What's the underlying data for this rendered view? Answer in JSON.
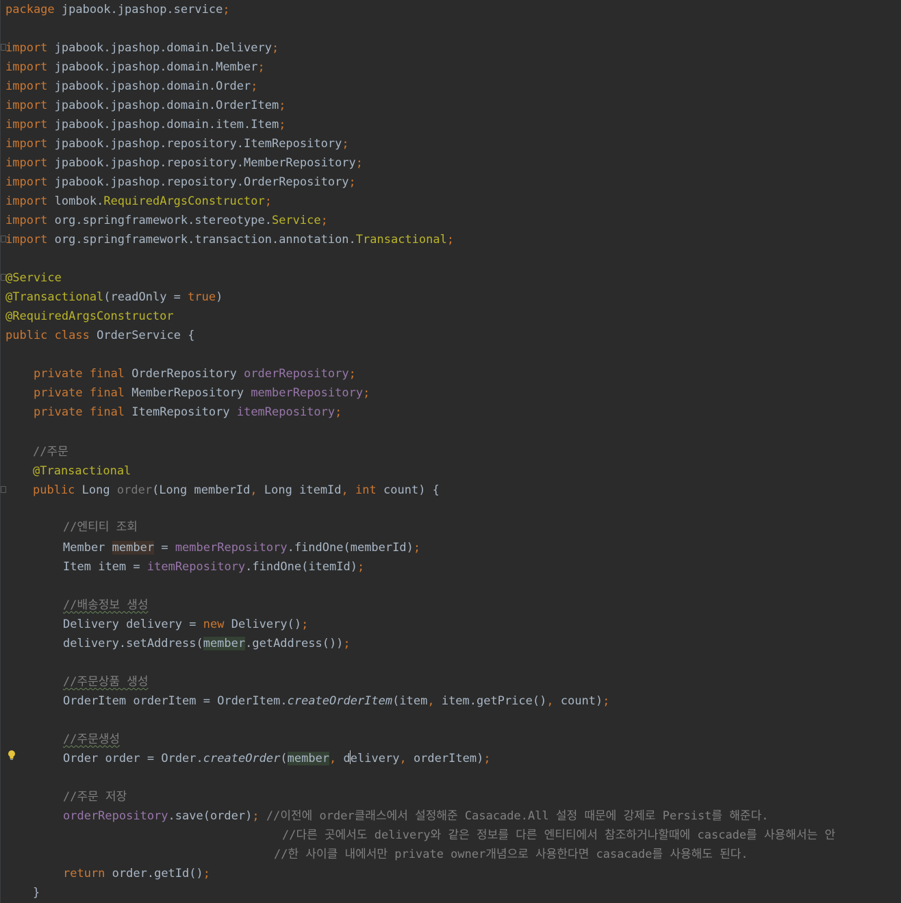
{
  "colors": {
    "background": "#2b2b2b",
    "keyword": "#cc7832",
    "annotation": "#bbb529",
    "field": "#9876aa",
    "comment": "#808080",
    "default_text": "#a9b7c6"
  },
  "icons": {
    "gutter_bulb": "lightbulb-icon",
    "fold_markers": "fold-marker-icon"
  },
  "code": {
    "package_kw": "package",
    "package_name": "jpabook.jpashop.service",
    "semicolon": ";",
    "import_kw": "import",
    "imports": [
      {
        "path": "jpabook.jpashop.domain.",
        "cls": "Delivery"
      },
      {
        "path": "jpabook.jpashop.domain.",
        "cls": "Member"
      },
      {
        "path": "jpabook.jpashop.domain.",
        "cls": "Order"
      },
      {
        "path": "jpabook.jpashop.domain.",
        "cls": "OrderItem"
      },
      {
        "path": "jpabook.jpashop.domain.item.",
        "cls": "Item"
      },
      {
        "path": "jpabook.jpashop.repository.",
        "cls": "ItemRepository"
      },
      {
        "path": "jpabook.jpashop.repository.",
        "cls": "MemberRepository"
      },
      {
        "path": "jpabook.jpashop.repository.",
        "cls": "OrderRepository"
      },
      {
        "path": "lombok.",
        "cls": "RequiredArgsConstructor"
      },
      {
        "path": "org.springframework.stereotype.",
        "cls": "Service"
      },
      {
        "path": "org.springframework.transaction.annotation.",
        "cls": "Transactional"
      }
    ],
    "ann_service": "@Service",
    "ann_transactional": "@Transactional",
    "readonly_param": "readOnly",
    "equals": " = ",
    "true_kw": "true",
    "ann_required": "@RequiredArgsConstructor",
    "public_kw": "public",
    "class_kw": "class",
    "class_name": "OrderService",
    "open_brace": "{",
    "close_brace": "}",
    "private_kw": "private",
    "final_kw": "final",
    "fields": [
      {
        "type": "OrderRepository",
        "name": "orderRepository"
      },
      {
        "type": "MemberRepository",
        "name": "memberRepository"
      },
      {
        "type": "ItemRepository",
        "name": "itemRepository"
      }
    ],
    "comment_order": "//주문",
    "long_type": "Long",
    "method_name": "order",
    "param_member": "memberId",
    "param_item": "itemId",
    "int_kw": "int",
    "param_count": "count",
    "comment_entity": "//엔티티 조회",
    "member_type": "Member",
    "member_var": "member",
    "member_repo": "memberRepository",
    "find_one": ".findOne",
    "item_type": "Item",
    "item_var": "item",
    "item_repo": "itemRepository",
    "comment_delivery": "//배송정보 생성",
    "delivery_type": "Delivery",
    "delivery_var": "delivery",
    "new_kw": "new",
    "set_address": "delivery.setAddress(",
    "get_address": ".getAddress())",
    "comment_orderitem": "//주문상품 생성",
    "orderitem_type": "OrderItem",
    "orderitem_var": "orderItem",
    "create_orderitem": "createOrderItem",
    "get_price": "item.getPrice()",
    "comment_create_order": "//주문생성",
    "order_type": "Order",
    "order_var": "order",
    "create_order": "createOrder",
    "comment_save": "//주문 저장",
    "order_repo": "orderRepository",
    "save_call": ".save(order)",
    "comment_cascade_1": "//이전에 order클래스에서 설정해준 Casacade.All 설정 때문에 강제로 Persist를 해준다.",
    "comment_cascade_2": "//다른 곳에서도 delivery와 같은 정보를 다른 엔티티에서 참조하거나할때에 cascade를 사용해서는 안",
    "comment_cascade_3": "//한 사이클 내에서만 private owner개념으로 사용한다면 casacade를 사용해도 된다.",
    "return_kw": "return",
    "get_id": "order.getId()"
  }
}
